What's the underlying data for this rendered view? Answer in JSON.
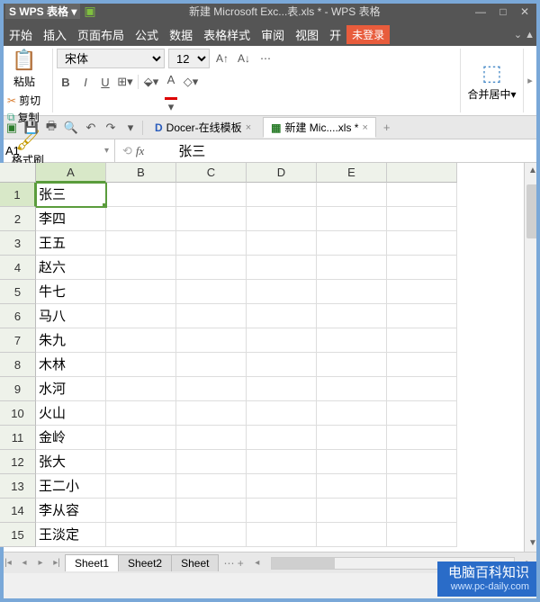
{
  "titlebar": {
    "app_name": "WPS 表格",
    "doc_title": "新建 Microsoft Exc...表.xls * - WPS 表格"
  },
  "menubar": {
    "items": [
      "开始",
      "插入",
      "页面布局",
      "公式",
      "数据",
      "表格样式",
      "审阅",
      "视图",
      "开"
    ],
    "not_logged": "未登录"
  },
  "ribbon": {
    "cut": "剪切",
    "copy": "复制",
    "paste": "粘贴",
    "format_painter": "格式刷",
    "font_name": "宋体",
    "font_size": "12",
    "merge": "合并居中"
  },
  "doc_tabs": {
    "tab1": "Docer-在线模板",
    "tab2": "新建 Mic....xls *"
  },
  "formula_bar": {
    "cell_ref": "A1",
    "value": "张三"
  },
  "columns": [
    "A",
    "B",
    "C",
    "D",
    "E"
  ],
  "rows": [
    "1",
    "2",
    "3",
    "4",
    "5",
    "6",
    "7",
    "8",
    "9",
    "10",
    "11",
    "12",
    "13",
    "14",
    "15"
  ],
  "cells_colA": [
    "张三",
    "李四",
    "王五",
    "赵六",
    "牛七",
    "马八",
    "朱九",
    "木林",
    "水河",
    "火山",
    "金岭",
    "张大",
    "王二小",
    "李从容",
    "王淡定"
  ],
  "sheets": {
    "s1": "Sheet1",
    "s2": "Sheet2",
    "s3": "Sheet"
  },
  "watermark": {
    "text": "电脑百科知识",
    "url": "www.pc-daily.com"
  }
}
